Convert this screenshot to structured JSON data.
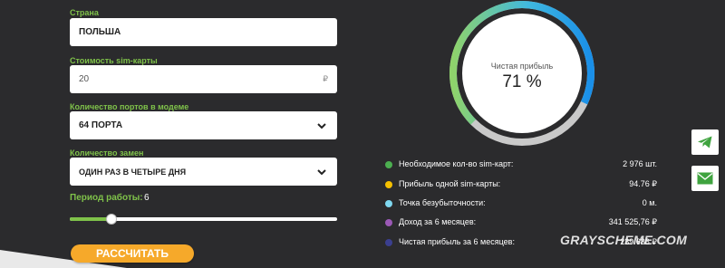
{
  "form": {
    "country": {
      "label": "Страна",
      "value": "ПОЛЬША"
    },
    "sim_cost": {
      "label": "Стоимость sim-карты",
      "value": "20",
      "unit": "₽"
    },
    "ports": {
      "label": "Количество портов в модеме",
      "value": "64 ПОРТА"
    },
    "replacements": {
      "label": "Количество замен",
      "value": "ОДИН РАЗ В ЧЕТЫРЕ ДНЯ"
    },
    "period": {
      "label": "Период работы:",
      "value": "6",
      "slider_fraction": 0.155
    },
    "calculate_label": "РАССЧИТАТЬ"
  },
  "gauge": {
    "title": "Чистая прибыль",
    "value_text": "71 %",
    "percent": 71
  },
  "stats": [
    {
      "label": "Необходимое кол-во sim-карт:",
      "value": "2 976 шт.",
      "color": "#4caf50"
    },
    {
      "label": "Прибыль одной sim-карты:",
      "value": "94.76 ₽",
      "color": "#f5c000"
    },
    {
      "label": "Точка безубыточности:",
      "value": "0 м.",
      "color": "#7fd8f0"
    },
    {
      "label": "Доход за 6 месяцев:",
      "value": "341 525,76 ₽",
      "color": "#9b59b6"
    },
    {
      "label": "Чистая прибыль за 6 месяцев:",
      "value": "239 686 ₽",
      "color": "#3b3f8f"
    }
  ],
  "side_icons": [
    "telegram-icon",
    "mail-icon"
  ],
  "colors": {
    "accent_green": "#7fc24a",
    "button_orange": "#f6a92a",
    "background": "#2b2b2d"
  },
  "watermark": "GRAYSCHEME.COM"
}
